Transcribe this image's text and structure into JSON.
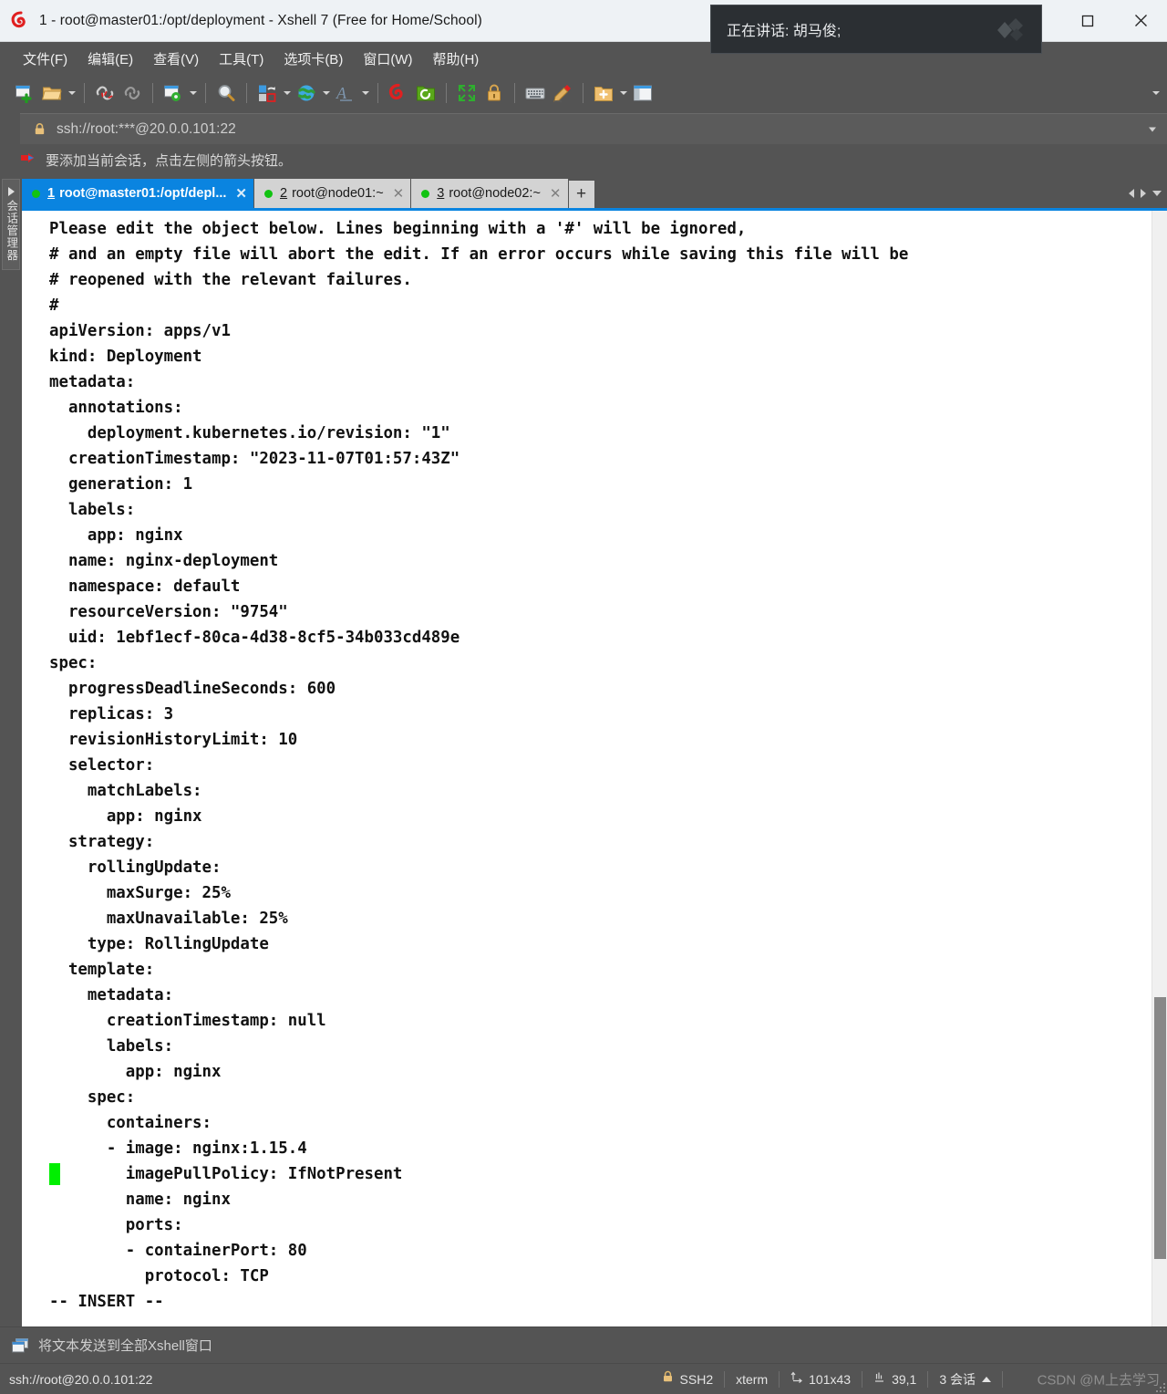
{
  "window": {
    "title": "1 - root@master01:/opt/deployment - Xshell 7 (Free for Home/School)",
    "logo_icon": "xshell-spiral-icon",
    "minimize_icon": "minimize-icon",
    "maximize_icon": "maximize-icon",
    "close_icon": "close-icon"
  },
  "menubar": {
    "items": [
      {
        "label": "文件(F)"
      },
      {
        "label": "编辑(E)"
      },
      {
        "label": "查看(V)"
      },
      {
        "label": "工具(T)"
      },
      {
        "label": "选项卡(B)"
      },
      {
        "label": "窗口(W)"
      },
      {
        "label": "帮助(H)"
      }
    ]
  },
  "speak_overlay": {
    "text": "正在讲话:  胡马俊;",
    "logo_icon": "diamond-logo-icon"
  },
  "toolbar": {
    "buttons": [
      {
        "name": "new-session-icon"
      },
      {
        "name": "open-session-icon"
      },
      {
        "name": "disconnect-icon"
      },
      {
        "name": "reconnect-icon"
      },
      {
        "name": "session-properties-icon"
      },
      {
        "name": "find-icon"
      },
      {
        "name": "file-transfer-icon"
      },
      {
        "name": "globe-icon"
      },
      {
        "name": "font-icon"
      },
      {
        "name": "xshell-icon"
      },
      {
        "name": "xftp-icon"
      },
      {
        "name": "fullscreen-icon"
      },
      {
        "name": "lock-icon"
      },
      {
        "name": "keyboard-icon"
      },
      {
        "name": "highlight-icon"
      },
      {
        "name": "add-folder-icon"
      },
      {
        "name": "layout-icon"
      }
    ]
  },
  "addressbar": {
    "lock_icon": "lock-icon",
    "value": "ssh://root:***@20.0.0.101:22",
    "dropdown_icon": "chevron-down-icon"
  },
  "hintbar": {
    "arrow_icon": "red-arrow-icon",
    "text": "要添加当前会话，点击左侧的箭头按钮。"
  },
  "sidebar": {
    "label": "会话管理器",
    "expand_icon": "expand-arrow-icon"
  },
  "tabs": {
    "items": [
      {
        "num": "1",
        "label": "root@master01:/opt/depl...",
        "active": true,
        "status": "connected"
      },
      {
        "num": "2",
        "label": "root@node01:~",
        "active": false,
        "status": "connected"
      },
      {
        "num": "3",
        "label": "root@node02:~",
        "active": false,
        "status": "connected"
      }
    ],
    "new_tab_label": "+",
    "nav_left_icon": "chevron-left-icon",
    "nav_right_icon": "chevron-right-icon",
    "nav_list_icon": "chevron-down-icon"
  },
  "terminal": {
    "lines": [
      "Please edit the object below. Lines beginning with a '#' will be ignored,",
      "# and an empty file will abort the edit. If an error occurs while saving this file will be",
      "# reopened with the relevant failures.",
      "#",
      "apiVersion: apps/v1",
      "kind: Deployment",
      "metadata:",
      "  annotations:",
      "    deployment.kubernetes.io/revision: \"1\"",
      "  creationTimestamp: \"2023-11-07T01:57:43Z\"",
      "  generation: 1",
      "  labels:",
      "    app: nginx",
      "  name: nginx-deployment",
      "  namespace: default",
      "  resourceVersion: \"9754\"",
      "  uid: 1ebf1ecf-80ca-4d38-8cf5-34b033cd489e",
      "spec:",
      "  progressDeadlineSeconds: 600",
      "  replicas: 3",
      "  revisionHistoryLimit: 10",
      "  selector:",
      "    matchLabels:",
      "      app: nginx",
      "  strategy:",
      "    rollingUpdate:",
      "      maxSurge: 25%",
      "      maxUnavailable: 25%",
      "    type: RollingUpdate",
      "  template:",
      "    metadata:",
      "      creationTimestamp: null",
      "      labels:",
      "        app: nginx",
      "    spec:",
      "      containers:",
      "      - image: nginx:1.15.4",
      "        imagePullPolicy: IfNotPresent",
      "        name: nginx",
      "        ports:",
      "        - containerPort: 80",
      "          protocol: TCP",
      "-- INSERT --"
    ],
    "cursor_line_index": 37,
    "cursor_color": "#00ef00"
  },
  "sendbar": {
    "icon": "send-to-all-windows-icon",
    "text": "将文本发送到全部Xshell窗口"
  },
  "statusbar": {
    "url": "ssh://root@20.0.0.101:22",
    "security_icon": "lock-icon",
    "security": "SSH2",
    "term_type": "xterm",
    "size_icon": "size-icon",
    "size": "101x43",
    "cursor_icon": "cursor-pos-icon",
    "cursor_pos": "39,1",
    "sessions": "3 会话",
    "sessions_caret_icon": "chevron-up-icon",
    "watermark": "CSDN @M上去学习"
  }
}
